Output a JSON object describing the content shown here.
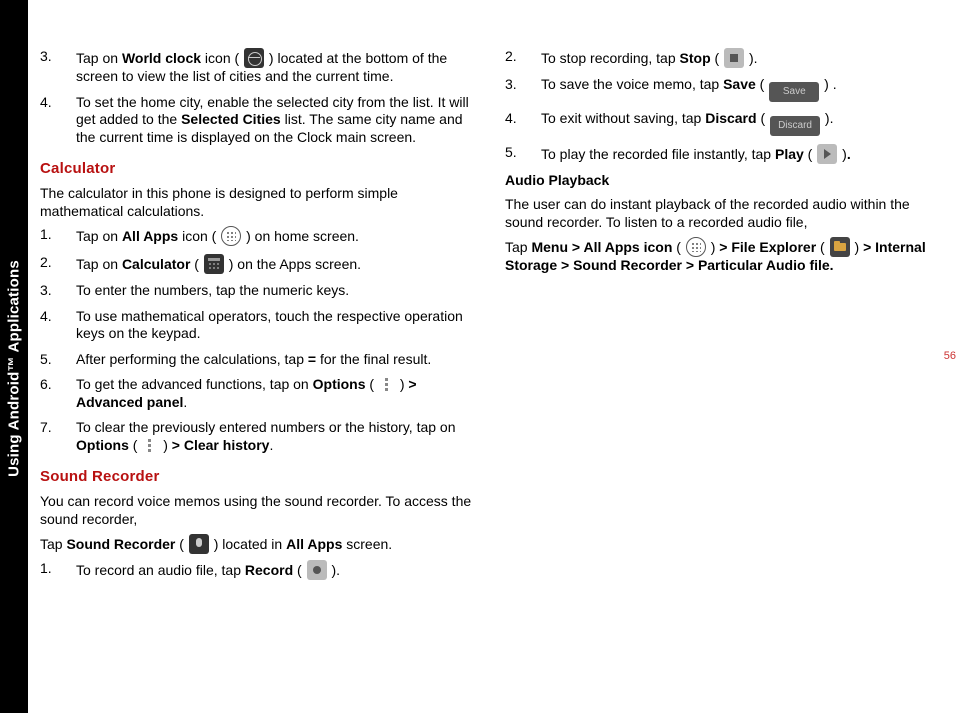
{
  "sidebar": {
    "label": "Using Android™ Applications"
  },
  "pageNumber": "56",
  "left": {
    "items34": [
      {
        "num": "3.",
        "pre": "Tap on ",
        "b1": "World clock",
        "mid": " icon ( ",
        "post": " ) located at the bottom of the screen to view the list of cities and the current time."
      },
      {
        "num": "4.",
        "text1": "To set the home city, enable the selected city from the list. It will get added to the ",
        "b1": "Selected Cities",
        "text2": " list. The same city name and the current time is displayed on the Clock main screen."
      }
    ],
    "calcHeading": "Calculator",
    "calcIntro": "The calculator in this phone is designed to perform simple mathematical calculations.",
    "calcList": [
      {
        "num": "1.",
        "t1": "Tap on ",
        "b1": "All Apps",
        "t2": " icon ( ",
        "t3": " ) on home screen."
      },
      {
        "num": "2.",
        "t1": "Tap on ",
        "b1": "Calculator",
        "t2": " ( ",
        "t3": " ) on the Apps screen."
      },
      {
        "num": "3.",
        "t1": "To enter the numbers, tap the numeric keys."
      },
      {
        "num": "4.",
        "t1": "To use mathematical operators, touch the respective operation keys on the keypad."
      },
      {
        "num": "5.",
        "t1": "After performing the calculations, tap ",
        "b1": "=",
        "t2": " for the final result."
      },
      {
        "num": "6.",
        "t1": "To get the advanced functions, tap on ",
        "b1": "Options",
        "t2": " ( ",
        "t3": " ) ",
        "b2": "> Advanced panel",
        "t4": "."
      },
      {
        "num": "7.",
        "t1": "To clear the previously entered numbers or the history, tap on ",
        "b1": "Options",
        "t2": " ( ",
        "t3": " ) ",
        "b2": "> Clear history",
        "t4": "."
      }
    ],
    "srHeading": "Sound Recorder",
    "srIntro": "You can record voice memos using the sound recorder. To access the sound recorder,",
    "srTap": {
      "t1": "Tap ",
      "b1": "Sound Recorder",
      "t2": " ( ",
      "t3": " ) located in ",
      "b2": "All Apps",
      "t4": " screen."
    },
    "srList1": {
      "num": "1.",
      "t1": "To record an audio file, tap ",
      "b1": "Record",
      "t2": " ( ",
      "t3": " )."
    }
  },
  "right": {
    "list": [
      {
        "num": "2.",
        "t1": "To stop recording, tap ",
        "b1": "Stop",
        "t2": " ( ",
        "t3": " )."
      },
      {
        "num": "3.",
        "t1": "To save the voice memo, tap ",
        "b1": "Save",
        "t2": " ( ",
        "btn": "Save",
        "t3": " ) ."
      },
      {
        "num": "4.",
        "t1": "To exit without saving, tap ",
        "b1": "Discard",
        "t2": " ( ",
        "btn": "Discard",
        "t3": " )."
      },
      {
        "num": "5.",
        "t1": "To play the recorded file instantly, tap ",
        "b1": "Play",
        "t2": " ( ",
        "t3": " )",
        "t4": "."
      }
    ],
    "apHeading": "Audio Playback",
    "apIntro": "The user can do instant playback of the recorded audio within the sound recorder. To listen to a recorded audio file,",
    "apPath": {
      "t1": "Tap ",
      "b1": "Menu > All Apps icon",
      "t2": " ( ",
      "t3": " ) ",
      "b2": "> File Explorer",
      "t4": " ( ",
      "t5": " ) ",
      "b3": "> Internal Storage > Sound Recorder > Particular Audio file."
    }
  }
}
